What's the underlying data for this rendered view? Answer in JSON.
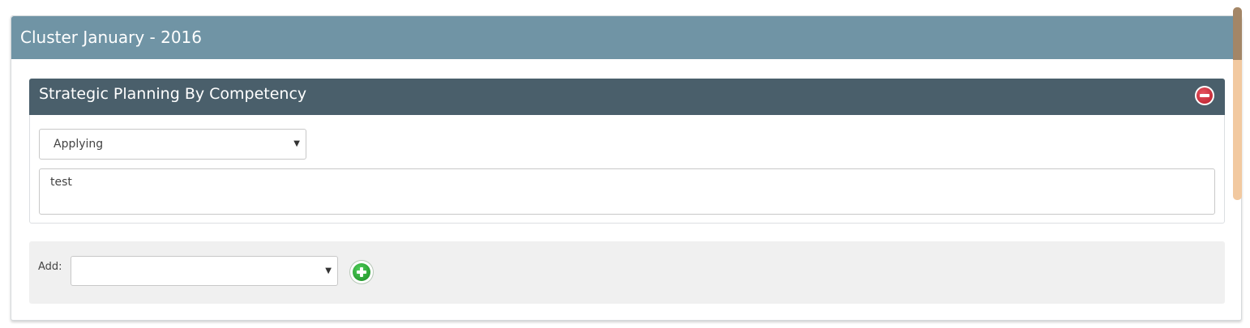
{
  "panel": {
    "title": "Cluster January - 2016"
  },
  "competency": {
    "title": "Strategic Planning By Competency",
    "level_value": "Applying",
    "notes_value": "test",
    "remove_icon": "minus-circle-icon"
  },
  "add_section": {
    "label": "Add:",
    "selected_value": "",
    "add_icon": "plus-circle-icon"
  },
  "colors": {
    "outer_header": "#7094a5",
    "inner_header": "#4a5f6b",
    "remove_button": "#c0272d",
    "add_button": "#2e9e35",
    "scrollbar_track": "#f2c9a0"
  }
}
